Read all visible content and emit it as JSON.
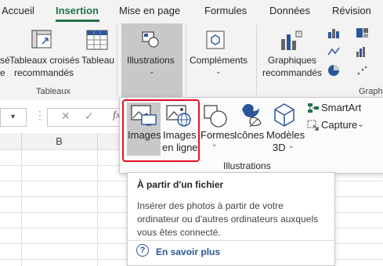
{
  "tabs": [
    "Accueil",
    "Insertion",
    "Mise en page",
    "Formules",
    "Données",
    "Révision"
  ],
  "active_tab": "Insertion",
  "ribbon": {
    "tableaux_group_label": "Tableaux",
    "partial_left_label": "sé",
    "partial_left_label2": "e",
    "tableaux_croises_line1": "Tableaux croisés",
    "tableaux_croises_line2": "recommandés",
    "tableau_label": "Tableau",
    "illustrations_label": "Illustrations",
    "complements_label": "Compléments",
    "graphiques_line1": "Graphiques",
    "graphiques_line2": "recommandés",
    "graphiques_group_partial": "Graph"
  },
  "formula_bar": {
    "fx": "fx"
  },
  "columns": [
    "B"
  ],
  "dropdown": {
    "images_label": "Images",
    "images_en_ligne_line1": "Images",
    "images_en_ligne_line2": "en ligne",
    "formes_label": "Formes",
    "icones_label": "Icônes",
    "modeles_line1": "Modèles",
    "modeles_line2": "3D",
    "smartart_label": "SmartArt",
    "capture_label": "Capture",
    "group_label": "Illustrations"
  },
  "tooltip": {
    "title": "À partir d'un fichier",
    "body": "Insérer des photos à partir de votre ordinateur ou d'autres ordinateurs auxquels vous êtes connecté.",
    "link": "En savoir plus"
  },
  "colors": {
    "accent": "#217346",
    "highlight": "#e81123",
    "link": "#2b579a"
  }
}
